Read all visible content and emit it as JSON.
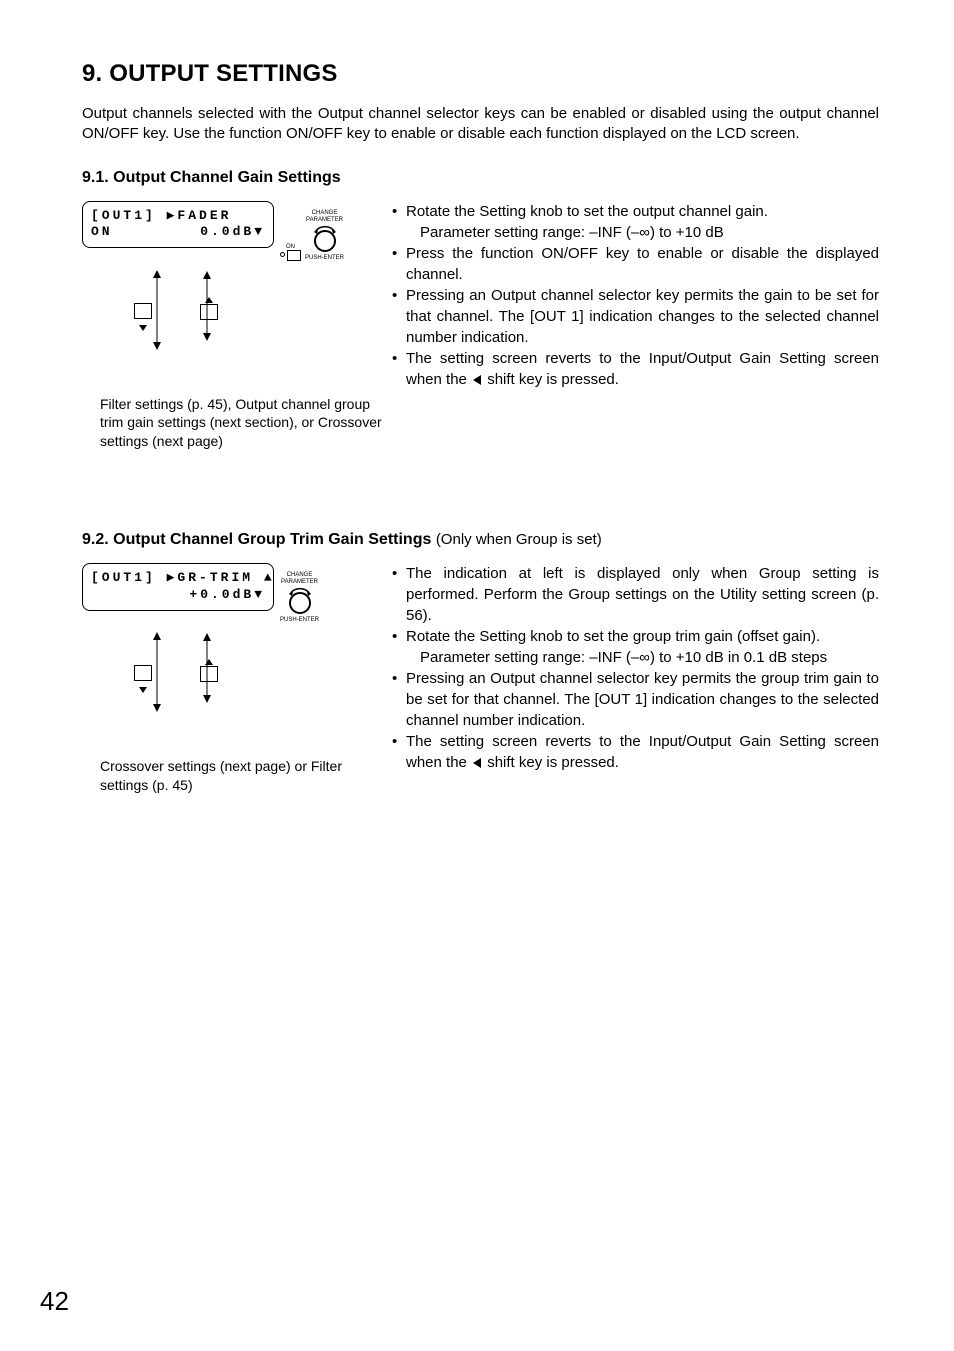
{
  "page_number": "42",
  "heading": "9. OUTPUT SETTINGS",
  "intro": "Output channels selected with the Output channel selector keys can be enabled or disabled using the output channel ON/OFF key. Use the function ON/OFF key to enable or disable each function displayed on the LCD screen.",
  "section1": {
    "title": "9.1. Output Channel Gain Settings",
    "lcd_line1": "[OUT1] ▶FADER",
    "lcd_line2_left": "ON",
    "lcd_line2_right": "0.0dB▼",
    "on_label": "ON",
    "knob_top1": "CHANGE",
    "knob_top2": "PARAMETER",
    "knob_bottom": "PUSH-ENTER",
    "nav_caption": "Filter settings (p. 45), Output channel group trim gain settings (next section), or Crossover settings (next page)",
    "bullets": [
      {
        "text": "Rotate the Setting knob to set the output channel gain.",
        "sub": "Parameter setting range: –INF (–∞) to +10 dB"
      },
      {
        "text": "Press the function ON/OFF key to enable or disable the displayed channel."
      },
      {
        "text": "Pressing an Output channel selector key permits the gain to be set for that channel. The [OUT 1] indication changes to the selected channel number indication."
      },
      {
        "text": "The setting screen reverts to the Input/Output Gain Setting screen when the ",
        "has_arrow": true,
        "tail": " shift key is pressed."
      }
    ]
  },
  "section2": {
    "title": "9.2. Output Channel Group Trim Gain Settings",
    "qualifier": "(Only when Group is set)",
    "lcd_line1": "[OUT1] ▶GR-TRIM ▲",
    "lcd_line2_left": "",
    "lcd_line2_right": "+0.0dB▼",
    "knob_top1": "CHANGE",
    "knob_top2": "PARAMETER",
    "knob_bottom": "PUSH-ENTER",
    "nav_caption": "Crossover settings (next page) or Filter settings (p. 45)",
    "bullets": [
      {
        "text": "The indication at left is displayed only when Group setting is performed. Perform the Group settings on the Utility setting screen (p. 56)."
      },
      {
        "text": "Rotate the Setting knob to set the group trim gain (offset gain).",
        "sub": "Parameter setting range: –INF (–∞) to +10 dB in 0.1 dB steps"
      },
      {
        "text": "Pressing an Output channel selector key permits the group trim gain to be set for that channel. The [OUT 1] indication changes to the selected channel number indication."
      },
      {
        "text": "The setting screen reverts to the Input/Output Gain Setting screen when the ",
        "has_arrow": true,
        "tail": " shift key is pressed."
      }
    ]
  }
}
